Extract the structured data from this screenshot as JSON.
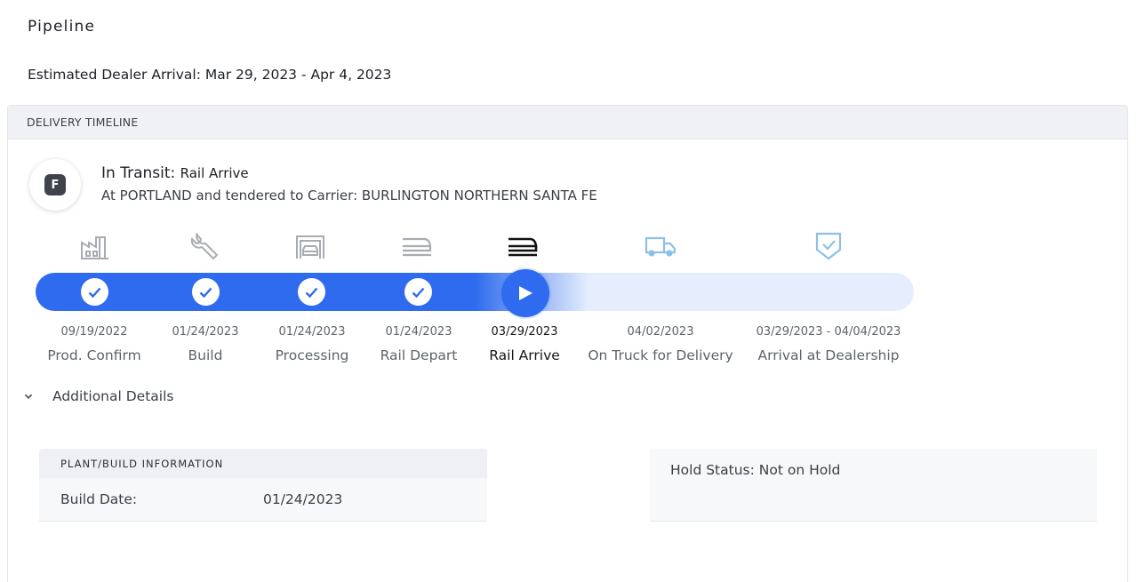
{
  "page": {
    "title": "Pipeline",
    "eta": "Estimated Dealer Arrival: Mar 29, 2023 - Apr 4, 2023"
  },
  "timeline": {
    "header": "DELIVERY TIMELINE",
    "avatar_letter": "F",
    "status_label": "In Transit:",
    "status_sub": "Rail Arrive",
    "status_desc": "At PORTLAND and tendered to Carrier: BURLINGTON NORTHERN SANTA FE",
    "progress_step": 5,
    "stages": [
      {
        "date": "09/19/2022",
        "name": "Prod. Confirm",
        "icon": "factory-icon",
        "state": "complete"
      },
      {
        "date": "01/24/2023",
        "name": "Build",
        "icon": "wrench-icon",
        "state": "complete"
      },
      {
        "date": "01/24/2023",
        "name": "Processing",
        "icon": "car-garage-icon",
        "state": "complete"
      },
      {
        "date": "01/24/2023",
        "name": "Rail Depart",
        "icon": "train-icon",
        "state": "complete"
      },
      {
        "date": "03/29/2023",
        "name": "Rail Arrive",
        "icon": "train-icon",
        "state": "current"
      },
      {
        "date": "04/02/2023",
        "name": "On Truck for Delivery",
        "icon": "truck-icon",
        "state": "upcoming"
      },
      {
        "date": "03/29/2023 - 04/04/2023",
        "name": "Arrival at Dealership",
        "icon": "shield-check-icon",
        "state": "upcoming"
      }
    ]
  },
  "details": {
    "toggle_label": "Additional Details",
    "plant": {
      "header": "PLANT/BUILD INFORMATION",
      "build_date_label": "Build Date:",
      "build_date_value": "01/24/2023"
    },
    "hold_status": "Hold Status: Not on Hold"
  },
  "colors": {
    "accent": "#2f6bee",
    "complete_icon": "#a8acb2",
    "current_icon": "#111111",
    "upcoming_icon": "#8cc0e6"
  }
}
